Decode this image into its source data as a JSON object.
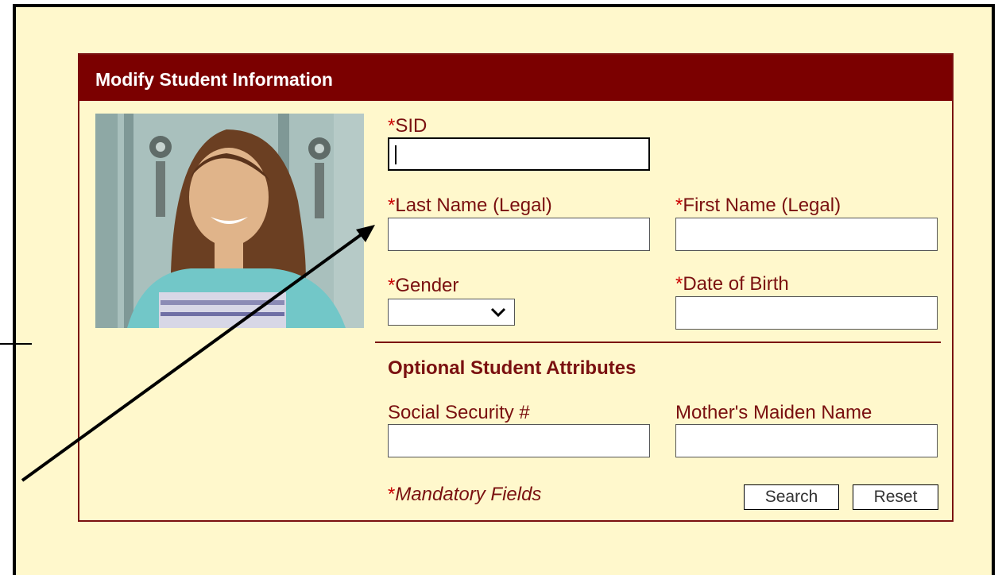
{
  "panel": {
    "title": "Modify Student Information"
  },
  "fields": {
    "sid": {
      "required_marker": "*",
      "label": "SID",
      "value": ""
    },
    "last_name": {
      "required_marker": "*",
      "label": "Last Name (Legal)",
      "value": ""
    },
    "first_name": {
      "required_marker": "*",
      "label": "First Name (Legal)",
      "value": ""
    },
    "gender": {
      "required_marker": "*",
      "label": "Gender",
      "selected": ""
    },
    "dob": {
      "required_marker": "*",
      "label": "Date of Birth",
      "value": ""
    }
  },
  "optional": {
    "title": "Optional Student Attributes",
    "ssn": {
      "label": "Social Security #",
      "value": ""
    },
    "maiden": {
      "label": "Mother's Maiden Name",
      "value": ""
    }
  },
  "footer": {
    "mandatory_marker": "*",
    "mandatory_label": "Mandatory Fields",
    "search_label": "Search",
    "reset_label": "Reset"
  },
  "icons": {
    "dropdown": "chevron-down-icon",
    "annotation": "arrow-icon"
  },
  "colors": {
    "header_bg": "#7b0000",
    "panel_bg": "#fff8cc",
    "label": "#7a1010",
    "required": "#cc0000"
  }
}
